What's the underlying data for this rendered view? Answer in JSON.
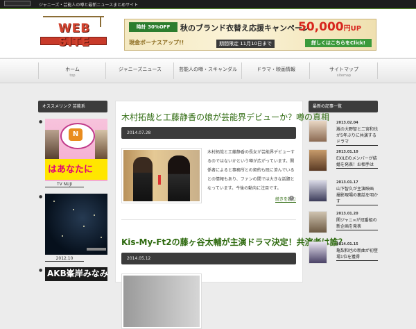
{
  "topbar": {
    "tagline": "ジャニーズ・芸能人の噂と最新ニュースまとめサイト"
  },
  "header": {
    "logo_text": "WEB SITE",
    "banner": {
      "badge": "時計 30%OFF",
      "headline": "秋のブランド衣替え応援キャンペーン",
      "amount": "50,000",
      "amount_unit": "円UP",
      "sub": "現金ボーナスアップ!!",
      "period": "期間限定 11月10日まで",
      "cta": "詳しくはこちらをClick!"
    }
  },
  "nav": {
    "items": [
      {
        "label": "ホーム",
        "sub": "top"
      },
      {
        "label": "ジャニーズニュース",
        "sub": ""
      },
      {
        "label": "芸能人の噂・スキャンダル",
        "sub": ""
      },
      {
        "label": "ドラマ・映画情報",
        "sub": ""
      },
      {
        "label": "サイトマップ",
        "sub": "sitemap"
      }
    ]
  },
  "left_sidebar": {
    "heading": "オススメリンク 芸能系",
    "links": [
      {
        "caption": "TV NUJI",
        "strip_text": "はあなたに"
      },
      {
        "caption": "2012.10",
        "strip_text": ""
      },
      {
        "caption": "",
        "strip_text": "AKB峯岸みなみ"
      }
    ]
  },
  "main": {
    "posts": [
      {
        "title": "木村拓哉と工藤静香の娘が芸能界デビューか？噂の真相",
        "date": "2014.07.28",
        "excerpt": "木村拓哉と工藤静香の長女が芸能界デビューするのではないかという噂が広がっています。関係者によると事務所との契約も既に済んでいるとの情報もあり、ファンの間では大きな話題となっています。今後の動向に注目です。",
        "more": "続きを読む"
      },
      {
        "title": "Kis-My-Ft2の藤ヶ谷太輔が主演ドラマ決定！共演者は誰？",
        "date": "2014.05.12"
      }
    ]
  },
  "right_sidebar": {
    "heading": "最新の記事一覧",
    "entries": [
      {
        "date": "2013.02.04",
        "title": "嵐の大野智と二宮和也が5年ぶりに共演するドラマ"
      },
      {
        "date": "2013.01.10",
        "title": "EXILEのメンバーが結婚を発表！お相手は"
      },
      {
        "date": "2013.01.17",
        "title": "山下智久が主演映画 撮影現場の裏話を明かす"
      },
      {
        "date": "2013.01.20",
        "title": "関ジャニ∞が冠番組の新企画を発表"
      },
      {
        "date": "2014.01.15",
        "title": "亀梨和也の新曲が初登場1位を獲得"
      }
    ]
  }
}
